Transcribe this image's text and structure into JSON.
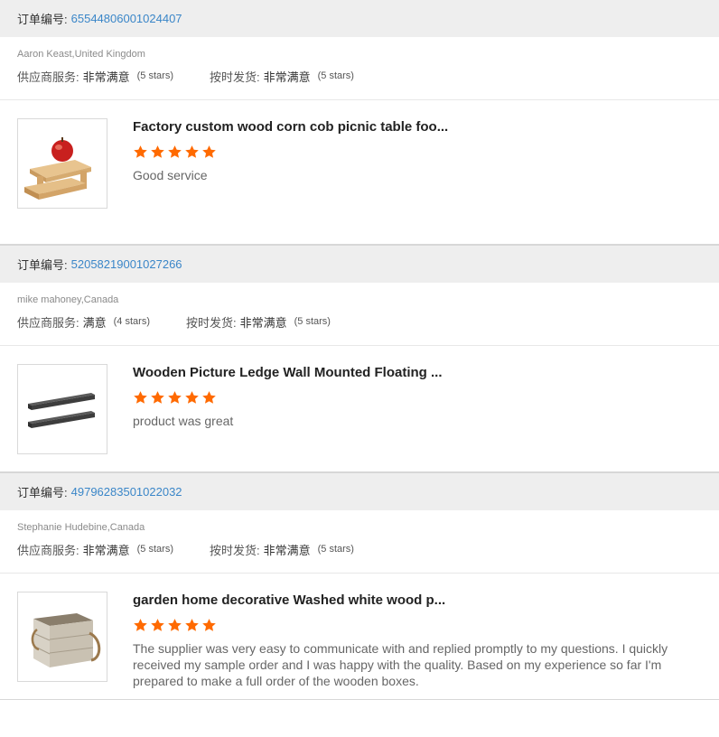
{
  "reviews": [
    {
      "order_label": "订单编号:",
      "order_number": "65544806001024407",
      "buyer": "Aaron Keast,United Kingdom",
      "supplier_service_label": "供应商服务:",
      "supplier_service_value": "非常满意",
      "supplier_service_stars": "(5 stars)",
      "shipping_label": "按时发货:",
      "shipping_value": "非常满意",
      "shipping_stars": "(5 stars)",
      "product_title": "Factory custom wood corn cob picnic table foo...",
      "rating": 5,
      "comment": "Good service",
      "thumbnail_icon": "picnic-table-with-apple"
    },
    {
      "order_label": "订单编号:",
      "order_number": "52058219001027266",
      "buyer": "mike mahoney,Canada",
      "supplier_service_label": "供应商服务:",
      "supplier_service_value": "满意",
      "supplier_service_stars": "(4 stars)",
      "shipping_label": "按时发货:",
      "shipping_value": "非常满意",
      "shipping_stars": "(5 stars)",
      "product_title": "Wooden Picture Ledge Wall Mounted Floating ...",
      "rating": 5,
      "comment": "product was great",
      "thumbnail_icon": "wall-ledge-shelves"
    },
    {
      "order_label": "订单编号:",
      "order_number": "49796283501022032",
      "buyer": "Stephanie Hudebine,Canada",
      "supplier_service_label": "供应商服务:",
      "supplier_service_value": "非常满意",
      "supplier_service_stars": "(5 stars)",
      "shipping_label": "按时发货:",
      "shipping_value": "非常满意",
      "shipping_stars": "(5 stars)",
      "product_title": "garden home decorative Washed white wood p...",
      "rating": 5,
      "comment": "The supplier was very easy to communicate with and replied promptly to my questions. I quickly received my sample order and I was happy with the quality. Based on my experience so far I'm prepared to make a full order of the wooden boxes.",
      "thumbnail_icon": "wooden-box-with-rope-handles"
    }
  ],
  "colors": {
    "star": "#ff6a00",
    "order_number": "#3a86c8",
    "header_bg": "#eeeeee"
  }
}
